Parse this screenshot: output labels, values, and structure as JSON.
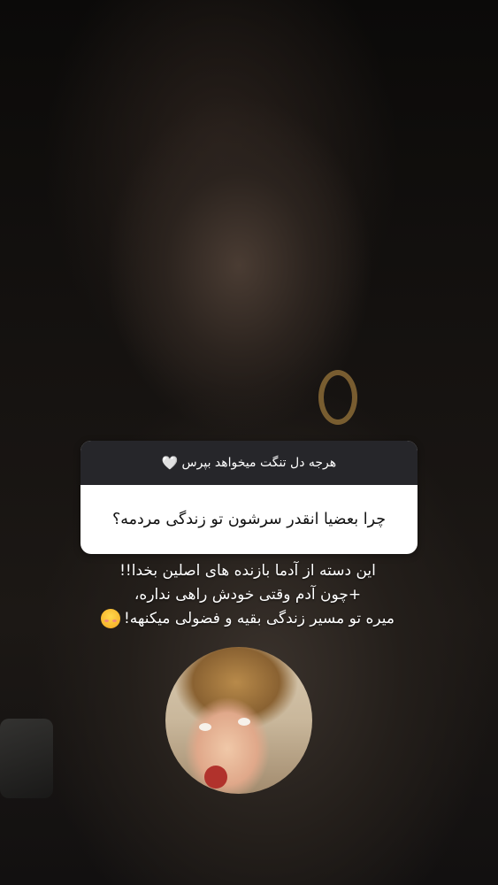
{
  "question_card": {
    "prompt": "هرجه دل تنگت میخواهد بپرس",
    "heart_icon": "🤍",
    "question": "چرا بعضیا انقدر سرشون تو زندگی مردمه؟"
  },
  "answer": {
    "line1": "این دسته از آدما بازنده های اصلین بخدا!!",
    "line2": "+چون آدم وقتی خودش راهی نداره،",
    "line3": "میره تو مسیر زندگی بقیه و فضولی میکنهه!",
    "emoji": "smiling-face-icon"
  },
  "sticker": {
    "icon": "surprised-child-sticker"
  }
}
